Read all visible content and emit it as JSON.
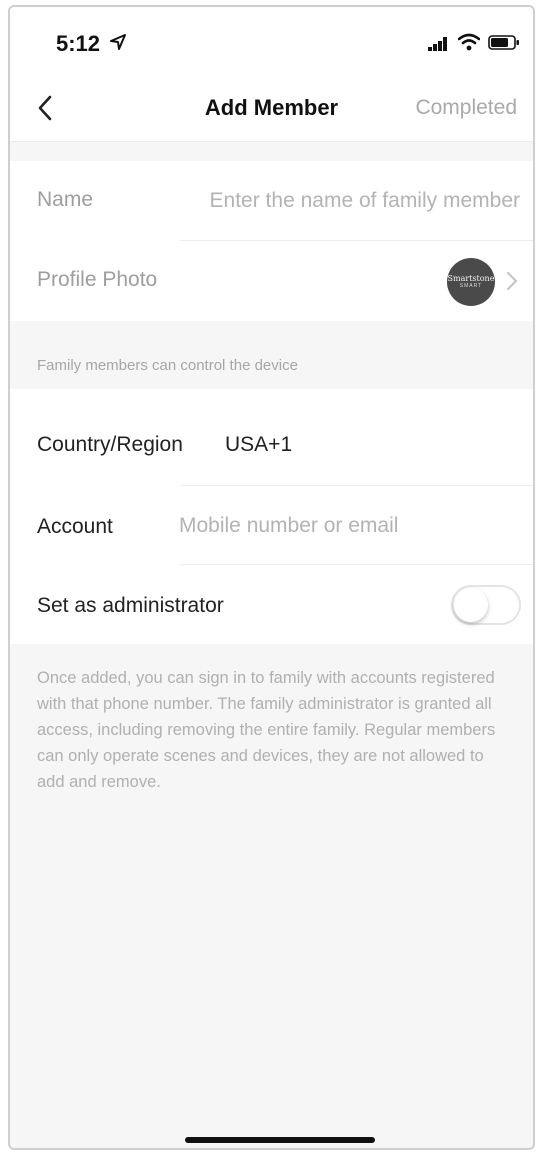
{
  "status_bar": {
    "time": "5:12"
  },
  "nav": {
    "title": "Add Member",
    "completed_label": "Completed"
  },
  "form": {
    "name_label": "Name",
    "name_placeholder": "Enter the name of family member",
    "photo_label": "Profile Photo",
    "avatar_line1": "Smartstone",
    "avatar_line2": "SMART",
    "section_note": "Family members can control the device",
    "country_label": "Country/Region",
    "country_value": "USA+1",
    "account_label": "Account",
    "account_placeholder": "Mobile number or email",
    "admin_label": "Set as administrator",
    "admin_enabled": false
  },
  "info_text": "Once added, you can sign in to family with accounts registered with that phone number. The family administrator is granted all access, including removing the entire family. Regular members can only operate scenes and devices, they are not allowed to add and remove.",
  "colors": {
    "background": "#f6f6f6",
    "card": "#ffffff",
    "muted_text": "#a9a9a9",
    "primary_text": "#222222"
  }
}
